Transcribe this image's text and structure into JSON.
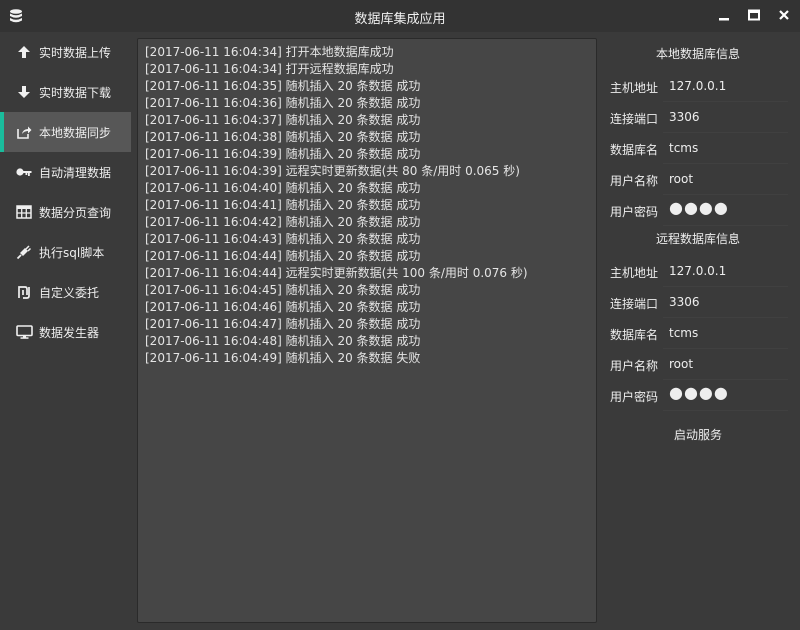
{
  "window": {
    "title": "数据库集成应用"
  },
  "sidebar": {
    "active_index": 2,
    "items": [
      {
        "label": "实时数据上传",
        "icon": "arrow-up-icon"
      },
      {
        "label": "实时数据下载",
        "icon": "arrow-down-icon"
      },
      {
        "label": "本地数据同步",
        "icon": "share-square-icon"
      },
      {
        "label": "自动清理数据",
        "icon": "key-icon"
      },
      {
        "label": "数据分页查询",
        "icon": "table-icon"
      },
      {
        "label": "执行sql脚本",
        "icon": "plug-icon"
      },
      {
        "label": "自定义委托",
        "icon": "shekel-icon"
      },
      {
        "label": "数据发生器",
        "icon": "desktop-icon"
      }
    ]
  },
  "log": [
    "[2017-06-11 16:04:34] 打开本地数据库成功",
    "[2017-06-11 16:04:34] 打开远程数据库成功",
    "[2017-06-11 16:04:35] 随机插入 20 条数据 成功",
    "[2017-06-11 16:04:36] 随机插入 20 条数据 成功",
    "[2017-06-11 16:04:37] 随机插入 20 条数据 成功",
    "[2017-06-11 16:04:38] 随机插入 20 条数据 成功",
    "[2017-06-11 16:04:39] 随机插入 20 条数据 成功",
    "[2017-06-11 16:04:39] 远程实时更新数据(共 80 条/用时 0.065 秒)",
    "[2017-06-11 16:04:40] 随机插入 20 条数据 成功",
    "[2017-06-11 16:04:41] 随机插入 20 条数据 成功",
    "[2017-06-11 16:04:42] 随机插入 20 条数据 成功",
    "[2017-06-11 16:04:43] 随机插入 20 条数据 成功",
    "[2017-06-11 16:04:44] 随机插入 20 条数据 成功",
    "[2017-06-11 16:04:44] 远程实时更新数据(共 100 条/用时 0.076 秒)",
    "[2017-06-11 16:04:45] 随机插入 20 条数据 成功",
    "[2017-06-11 16:04:46] 随机插入 20 条数据 成功",
    "[2017-06-11 16:04:47] 随机插入 20 条数据 成功",
    "[2017-06-11 16:04:48] 随机插入 20 条数据 成功",
    "[2017-06-11 16:04:49] 随机插入 20 条数据 失败"
  ],
  "local_db": {
    "title": "本地数据库信息",
    "fields": [
      {
        "label": "主机地址",
        "value": "127.0.0.1"
      },
      {
        "label": "连接端口",
        "value": "3306"
      },
      {
        "label": "数据库名",
        "value": "tcms"
      },
      {
        "label": "用户名称",
        "value": "root"
      },
      {
        "label": "用户密码",
        "value": "●●●●"
      }
    ]
  },
  "remote_db": {
    "title": "远程数据库信息",
    "fields": [
      {
        "label": "主机地址",
        "value": "127.0.0.1"
      },
      {
        "label": "连接端口",
        "value": "3306"
      },
      {
        "label": "数据库名",
        "value": "tcms"
      },
      {
        "label": "用户名称",
        "value": "root"
      },
      {
        "label": "用户密码",
        "value": "●●●●"
      }
    ]
  },
  "start_button": "启动服务",
  "colors": {
    "accent": "#1abc9c",
    "background": "#3a3a3a",
    "panel": "#464646",
    "active_item": "#575757"
  }
}
